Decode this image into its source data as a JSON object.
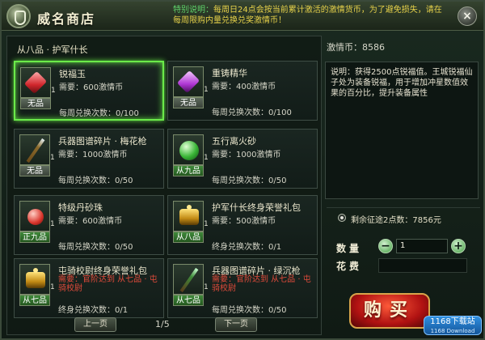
{
  "window": {
    "title": "威名商店",
    "notice_label": "特别说明：",
    "notice_text": "每周日24点会按当前累计激活的激情货币，为了避免损失，请在每周限购内量兑换兑奖激情币！"
  },
  "shop": {
    "category": "从八品 · 护军什长",
    "items": [
      {
        "name": "锐福玉",
        "need": "需要：600激情币",
        "limit": "每周兑换次数：0/100",
        "grade": "无品",
        "count": "1",
        "icon": "red-gem-icon"
      },
      {
        "name": "重铸精华",
        "need": "需要：400激情币",
        "limit": "每周兑换次数：0/100",
        "grade": "无品",
        "count": "1",
        "icon": "purple-gem-icon"
      },
      {
        "name": "兵器图谱碎片 · 梅花枪",
        "need": "需要：1000激情币",
        "limit": "每周兑换次数：0/50",
        "grade": "无品",
        "count": "1",
        "icon": "spear-icon"
      },
      {
        "name": "五行离火砂",
        "need": "需要：1000激情币",
        "limit": "每周兑换次数：0/50",
        "grade": "从九品",
        "count": "1",
        "icon": "green-orb-icon"
      },
      {
        "name": "特级丹砂珠",
        "need": "需要：600激情币",
        "limit": "每周兑换次数：0/50",
        "grade": "正九品",
        "count": "1",
        "icon": "red-pill-icon"
      },
      {
        "name": "护军什长终身荣誉礼包",
        "need": "需要：500激情币",
        "limit": "终身兑换次数：0/1",
        "grade": "从八品",
        "count": "1",
        "icon": "gold-pack-icon"
      },
      {
        "name": "屯骑校尉终身荣誉礼包",
        "need": "需要：官阶达到 从七品 · 屯骑校尉",
        "limit": "终身兑换次数：0/1",
        "grade": "从七品",
        "count": "1",
        "icon": "gold-pack-icon"
      },
      {
        "name": "兵器图谱碎片 · 绿沉枪",
        "need": "需要：官阶达到 从七品 · 屯骑校尉",
        "limit": "每周兑换次数：0/50",
        "grade": "从七品",
        "count": "1",
        "icon": "green-spear-icon"
      }
    ]
  },
  "pager": {
    "prev": "上一页",
    "page": "1/5",
    "next": "下一页"
  },
  "right": {
    "currency": "激情币：8586",
    "description": "说明：获得2500点锐福值。王城锐福仙子处为装备锐福，用于增加冲星数值效果的百分比，提升装备属性",
    "remaining_label": "剩余征途2点数：",
    "remaining_value": "7856元",
    "qty_label": "数量",
    "qty_value": "1",
    "cost_label": "花费",
    "buy_label": "购买",
    "site_mark": "1168下载站",
    "site_sub": "1168 Download"
  },
  "colors": {
    "accent_green": "#6bea4a",
    "need_red": "#e24b3b",
    "notice_yellow": "#e7d24a"
  }
}
